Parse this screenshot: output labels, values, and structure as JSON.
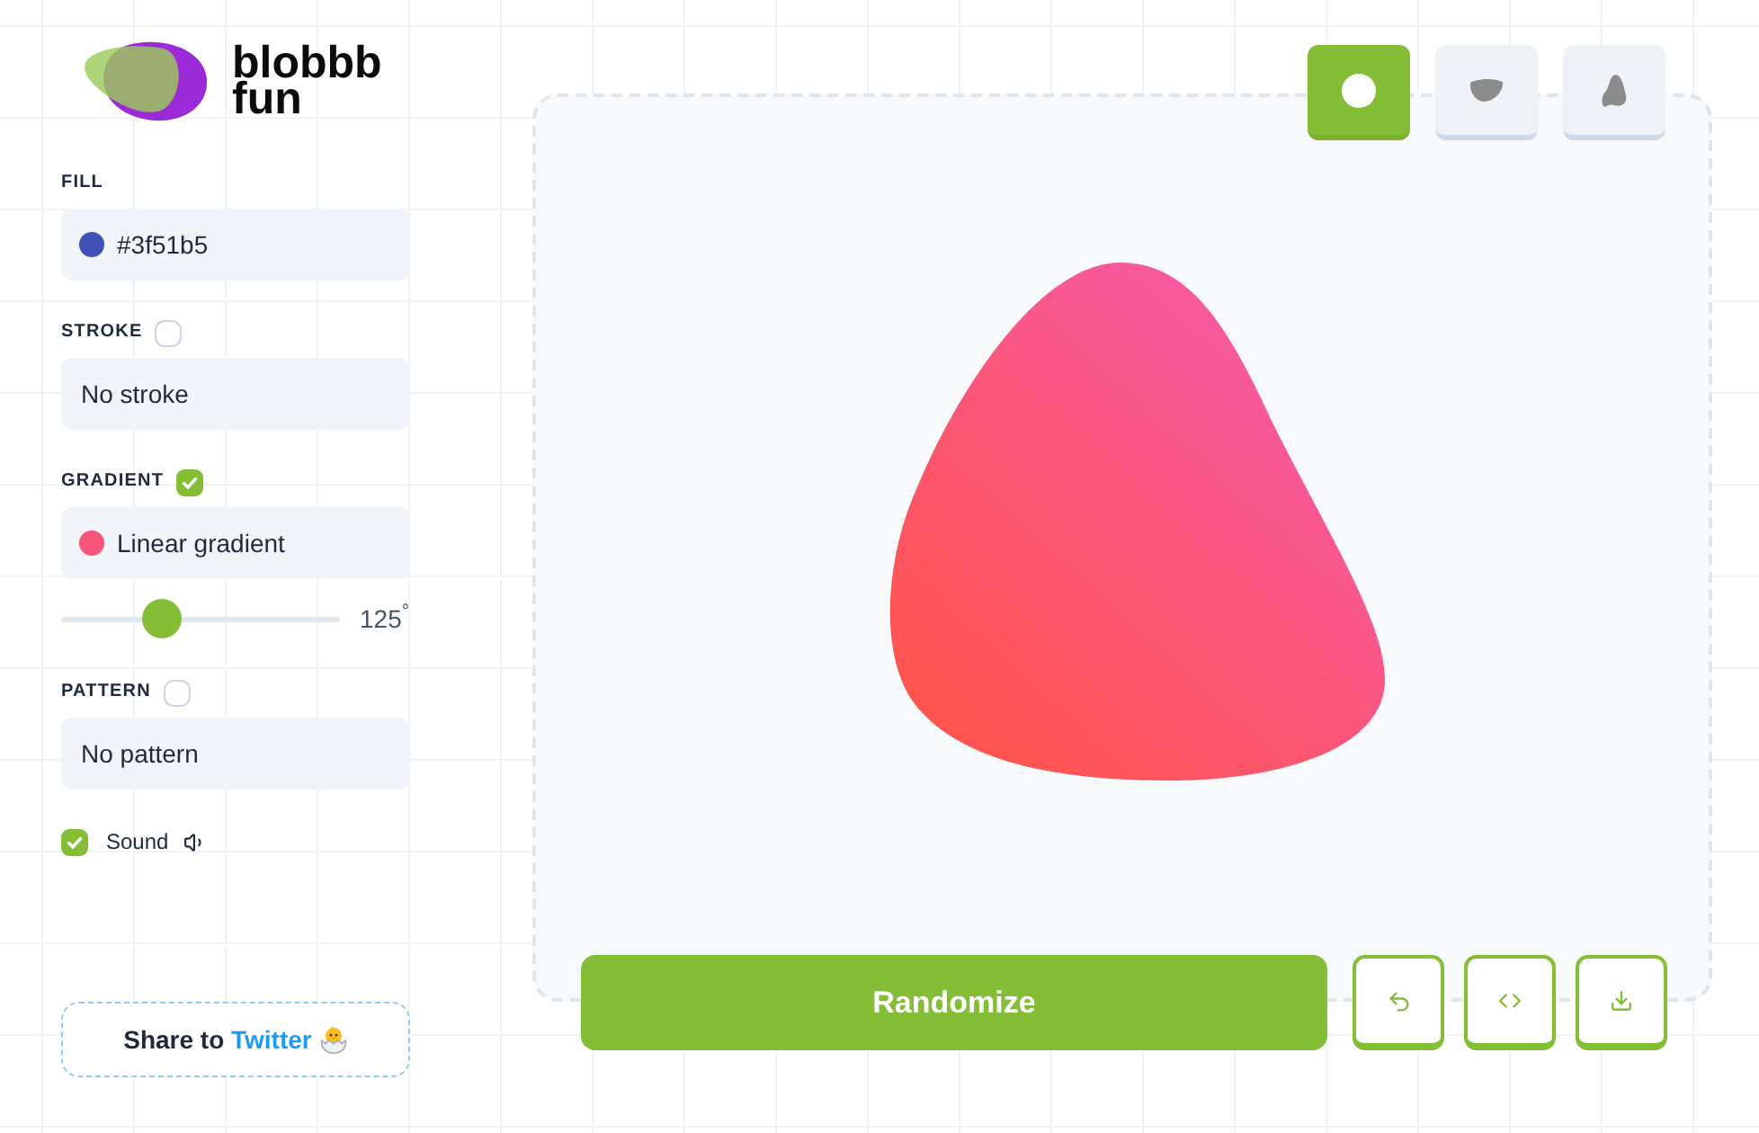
{
  "logo": {
    "text_lines": [
      "blobbb",
      "fun"
    ]
  },
  "settings": [
    {
      "kind": "field",
      "label": "FILL",
      "value": "#3f51b5",
      "color": "#3f51b5"
    },
    {
      "kind": "toggle-field",
      "label": "STROKE",
      "checked": false,
      "value": "No stroke"
    },
    {
      "kind": "toggle-field",
      "label": "GRADIENT",
      "checked": true,
      "value": "Linear gradient",
      "color": "#f7557a"
    },
    {
      "kind": "slider",
      "level": 0.36,
      "reading": "125$^{°}$"
    },
    {
      "kind": "toggle-field",
      "label": "PATTERN",
      "checked": false,
      "value": "No pattern"
    },
    {
      "kind": "checkbox",
      "label": "Sound",
      "checked": true
    }
  ],
  "share": {
    "label": "Share to",
    "link": "Twitter"
  },
  "shape_buttons": [
    {
      "selected": true
    },
    {
      "selected": false
    },
    {
      "selected": false
    }
  ],
  "randomize_button": "Randomize"
}
